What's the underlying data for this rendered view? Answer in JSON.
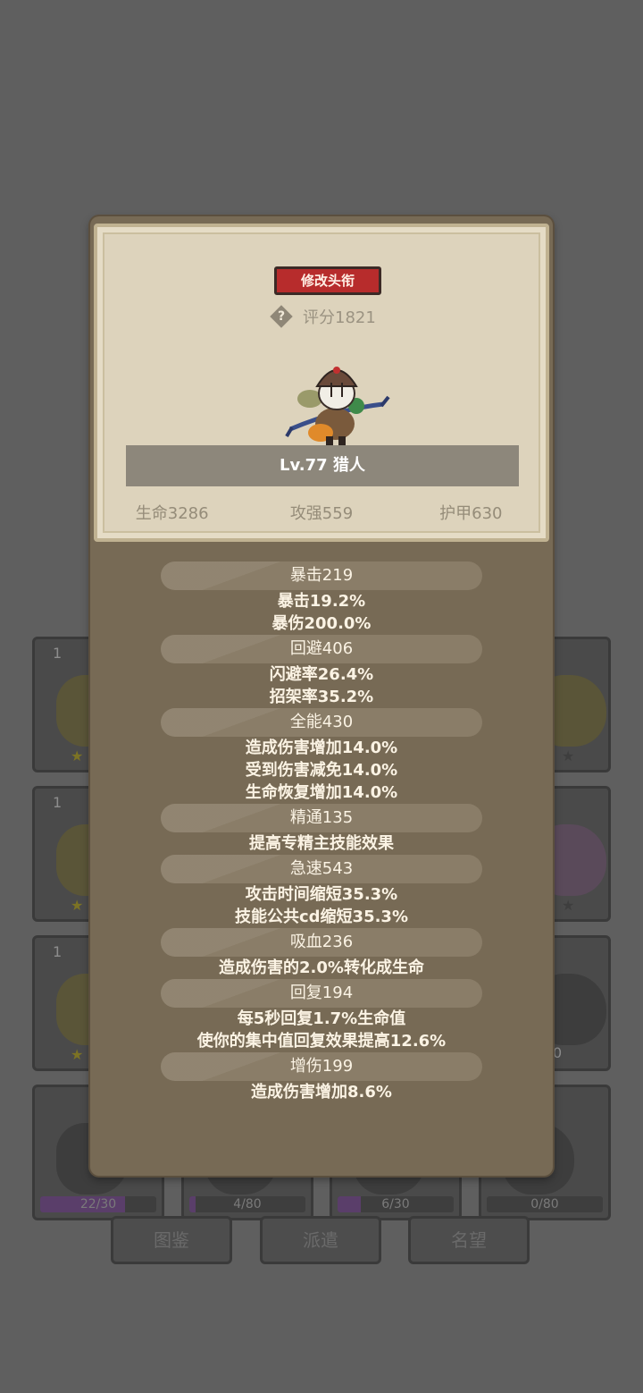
{
  "background": {
    "card_counts": [
      "1",
      "1",
      "1"
    ],
    "progress": [
      {
        "text": "22/30",
        "fraction": 0.73
      },
      {
        "text": "4/80",
        "fraction": 0.05
      },
      {
        "text": "6/30",
        "fraction": 0.2
      },
      {
        "text": "0/80",
        "fraction": 0.0
      }
    ],
    "partial_progress": "0",
    "tabs": [
      "图鉴",
      "派遣",
      "名望"
    ]
  },
  "profile": {
    "title_button": "修改头衔",
    "rating": "评分1821",
    "level_name": "Lv.77 猎人",
    "stats": [
      "生命3286",
      "攻强559",
      "护甲630"
    ]
  },
  "attributes": [
    {
      "head": "暴击219",
      "lines": [
        "暴击19.2%",
        "暴伤200.0%"
      ]
    },
    {
      "head": "回避406",
      "lines": [
        "闪避率26.4%",
        "招架率35.2%"
      ]
    },
    {
      "head": "全能430",
      "lines": [
        "造成伤害增加14.0%",
        "受到伤害减免14.0%",
        "生命恢复增加14.0%"
      ]
    },
    {
      "head": "精通135",
      "lines": [
        "提高专精主技能效果"
      ]
    },
    {
      "head": "急速543",
      "lines": [
        "攻击时间缩短35.3%",
        "技能公共cd缩短35.3%"
      ]
    },
    {
      "head": "吸血236",
      "lines": [
        "造成伤害的2.0%转化成生命"
      ]
    },
    {
      "head": "回复194",
      "lines": [
        "每5秒回复1.7%生命值",
        "使你的集中值回复效果提高12.6%"
      ]
    },
    {
      "head": "增伤199",
      "lines": [
        "造成伤害增加8.6%"
      ]
    }
  ],
  "colors": {
    "title_button": "#b72c2c",
    "modal": "#776a55",
    "parchment": "#ddd3bc"
  }
}
